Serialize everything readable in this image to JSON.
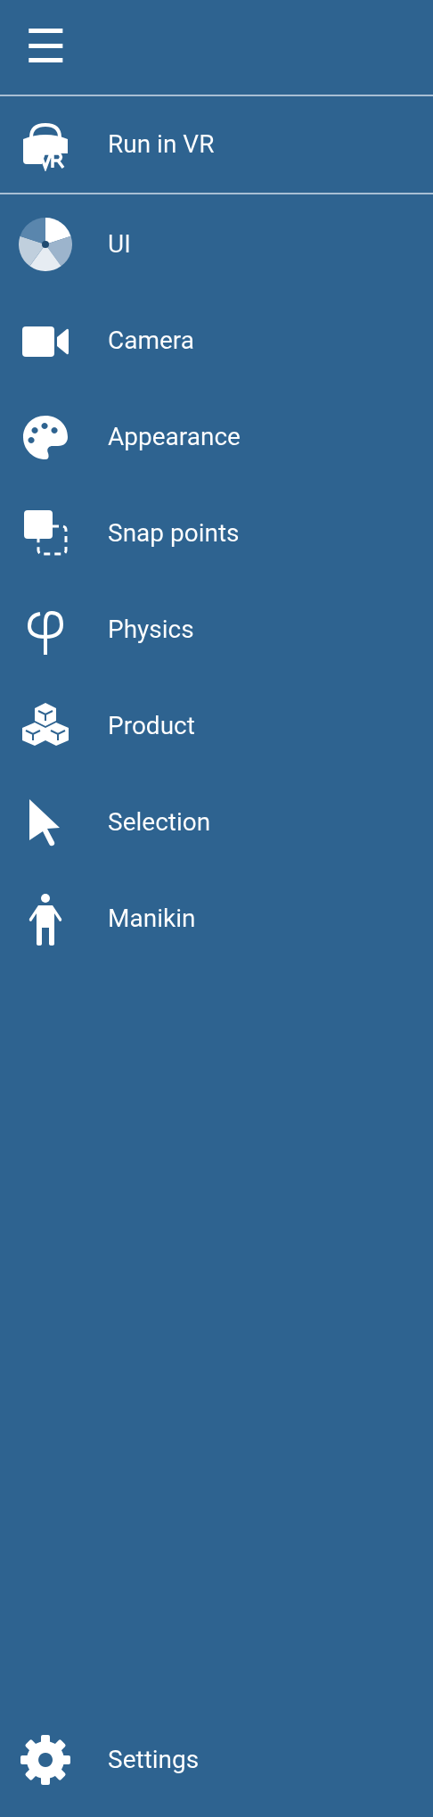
{
  "header": {
    "menu_button": "☰"
  },
  "run_item": {
    "label": "Run in VR",
    "kind": "vr"
  },
  "menu_items": [
    {
      "label": "UI",
      "kind": "ui"
    },
    {
      "label": "Camera",
      "kind": "camera"
    },
    {
      "label": "Appearance",
      "kind": "appearance"
    },
    {
      "label": "Snap points",
      "kind": "snap"
    },
    {
      "label": "Physics",
      "kind": "physics"
    },
    {
      "label": "Product",
      "kind": "product"
    },
    {
      "label": "Selection",
      "kind": "selection"
    },
    {
      "label": "Manikin",
      "kind": "manikin"
    }
  ],
  "footer_item": {
    "label": "Settings",
    "kind": "settings"
  }
}
